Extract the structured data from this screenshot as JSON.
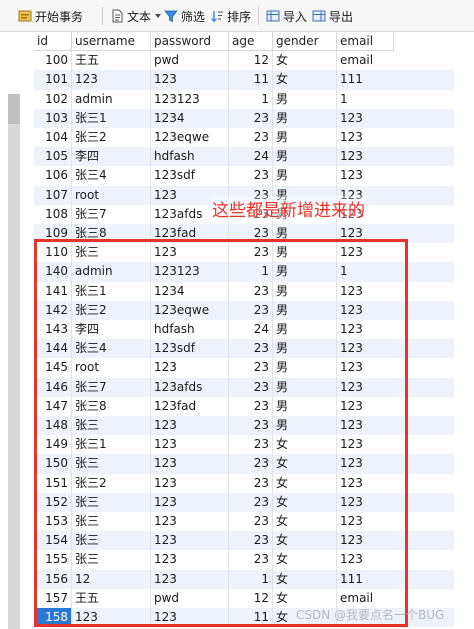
{
  "toolbar": {
    "begin_transaction": "开始事务",
    "text": "文本",
    "filter": "筛选",
    "sort": "排序",
    "import": "导入",
    "export": "导出"
  },
  "columns": [
    "id",
    "username",
    "password",
    "age",
    "gender",
    "email"
  ],
  "rows": [
    [
      "100",
      "王五",
      "pwd",
      "12",
      "女",
      "email"
    ],
    [
      "101",
      "123",
      "123",
      "11",
      "女",
      "111"
    ],
    [
      "102",
      "admin",
      "123123",
      "1",
      "男",
      "1"
    ],
    [
      "103",
      "张三1",
      "1234",
      "23",
      "男",
      "123"
    ],
    [
      "104",
      "张三2",
      "123eqwe",
      "23",
      "男",
      "123"
    ],
    [
      "105",
      "李四",
      "hdfash",
      "24",
      "男",
      "123"
    ],
    [
      "106",
      "张三4",
      "123sdf",
      "23",
      "男",
      "123"
    ],
    [
      "107",
      "root",
      "123",
      "23",
      "男",
      "123"
    ],
    [
      "108",
      "张三7",
      "123afds",
      "23",
      "男",
      "123"
    ],
    [
      "109",
      "张三8",
      "123fad",
      "23",
      "男",
      "123"
    ],
    [
      "110",
      "张三",
      "123",
      "23",
      "男",
      "123"
    ],
    [
      "140",
      "admin",
      "123123",
      "1",
      "男",
      "1"
    ],
    [
      "141",
      "张三1",
      "1234",
      "23",
      "男",
      "123"
    ],
    [
      "142",
      "张三2",
      "123eqwe",
      "23",
      "男",
      "123"
    ],
    [
      "143",
      "李四",
      "hdfash",
      "24",
      "男",
      "123"
    ],
    [
      "144",
      "张三4",
      "123sdf",
      "23",
      "男",
      "123"
    ],
    [
      "145",
      "root",
      "123",
      "23",
      "男",
      "123"
    ],
    [
      "146",
      "张三7",
      "123afds",
      "23",
      "男",
      "123"
    ],
    [
      "147",
      "张三8",
      "123fad",
      "23",
      "男",
      "123"
    ],
    [
      "148",
      "张三",
      "123",
      "23",
      "男",
      "123"
    ],
    [
      "149",
      "张三1",
      "123",
      "23",
      "女",
      "123"
    ],
    [
      "150",
      "张三",
      "123",
      "23",
      "女",
      "123"
    ],
    [
      "151",
      "张三2",
      "123",
      "23",
      "女",
      "123"
    ],
    [
      "152",
      "张三",
      "123",
      "23",
      "女",
      "123"
    ],
    [
      "153",
      "张三",
      "123",
      "23",
      "女",
      "123"
    ],
    [
      "154",
      "张三",
      "123",
      "23",
      "女",
      "123"
    ],
    [
      "155",
      "张三",
      "123",
      "23",
      "女",
      "123"
    ],
    [
      "156",
      "12",
      "123",
      "1",
      "女",
      "111"
    ],
    [
      "157",
      "王五",
      "pwd",
      "12",
      "女",
      "email"
    ],
    [
      "158",
      "123",
      "123",
      "11",
      "女",
      ""
    ]
  ],
  "selected_row_id": "158",
  "annotation": "这些都是新增进来的",
  "watermark": "CSDN @我要点名一个BUG",
  "colors": {
    "accent": "#2a78d6",
    "annotation_red": "#e8332b",
    "row_alt": "#eef3fb"
  }
}
